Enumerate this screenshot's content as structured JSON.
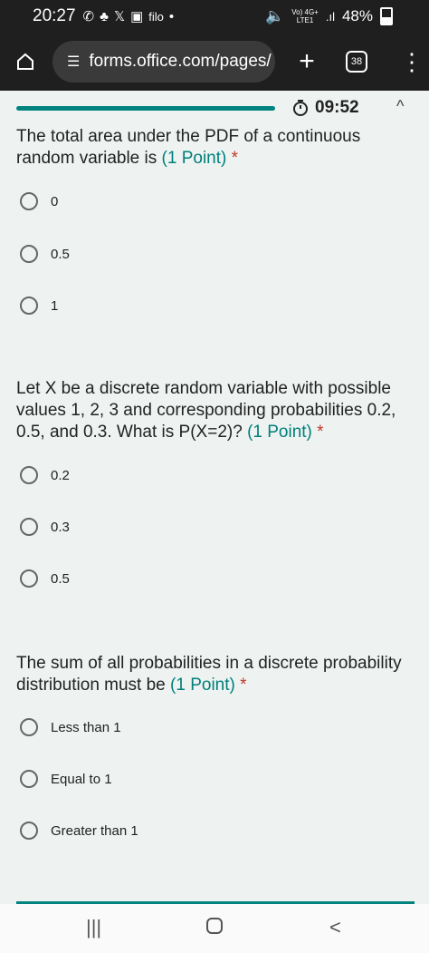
{
  "status": {
    "time": "20:27",
    "app_label": "filo",
    "network": "Vo) 4G+",
    "network_sub": "LTE1",
    "battery": "48%"
  },
  "browser": {
    "url": "forms.office.com/pages/",
    "tab_count": "38"
  },
  "form": {
    "timer": "09:52",
    "progress": 0.65
  },
  "questions": [
    {
      "text": "The total area under the PDF of a continuous random variable is",
      "points": "(1 Point)",
      "required": "*",
      "options": [
        "0",
        "0.5",
        "1"
      ]
    },
    {
      "text": "Let X be a discrete random variable with possible values 1, 2, 3 and corresponding probabilities 0.2, 0.5, and 0.3. What is P(X=2)?",
      "points": "(1 Point)",
      "required": "*",
      "options": [
        "0.2",
        "0.3",
        "0.5"
      ]
    },
    {
      "text": "The sum of all probabilities in a discrete probability distribution must be",
      "points": "(1 Point)",
      "required": "*",
      "options": [
        "Less than 1",
        "Equal to 1",
        "Greater than 1"
      ]
    }
  ],
  "colors": {
    "accent": "#00837f",
    "required": "#c0392b",
    "background": "#eef3f2",
    "bar": "#1f1f1f"
  }
}
